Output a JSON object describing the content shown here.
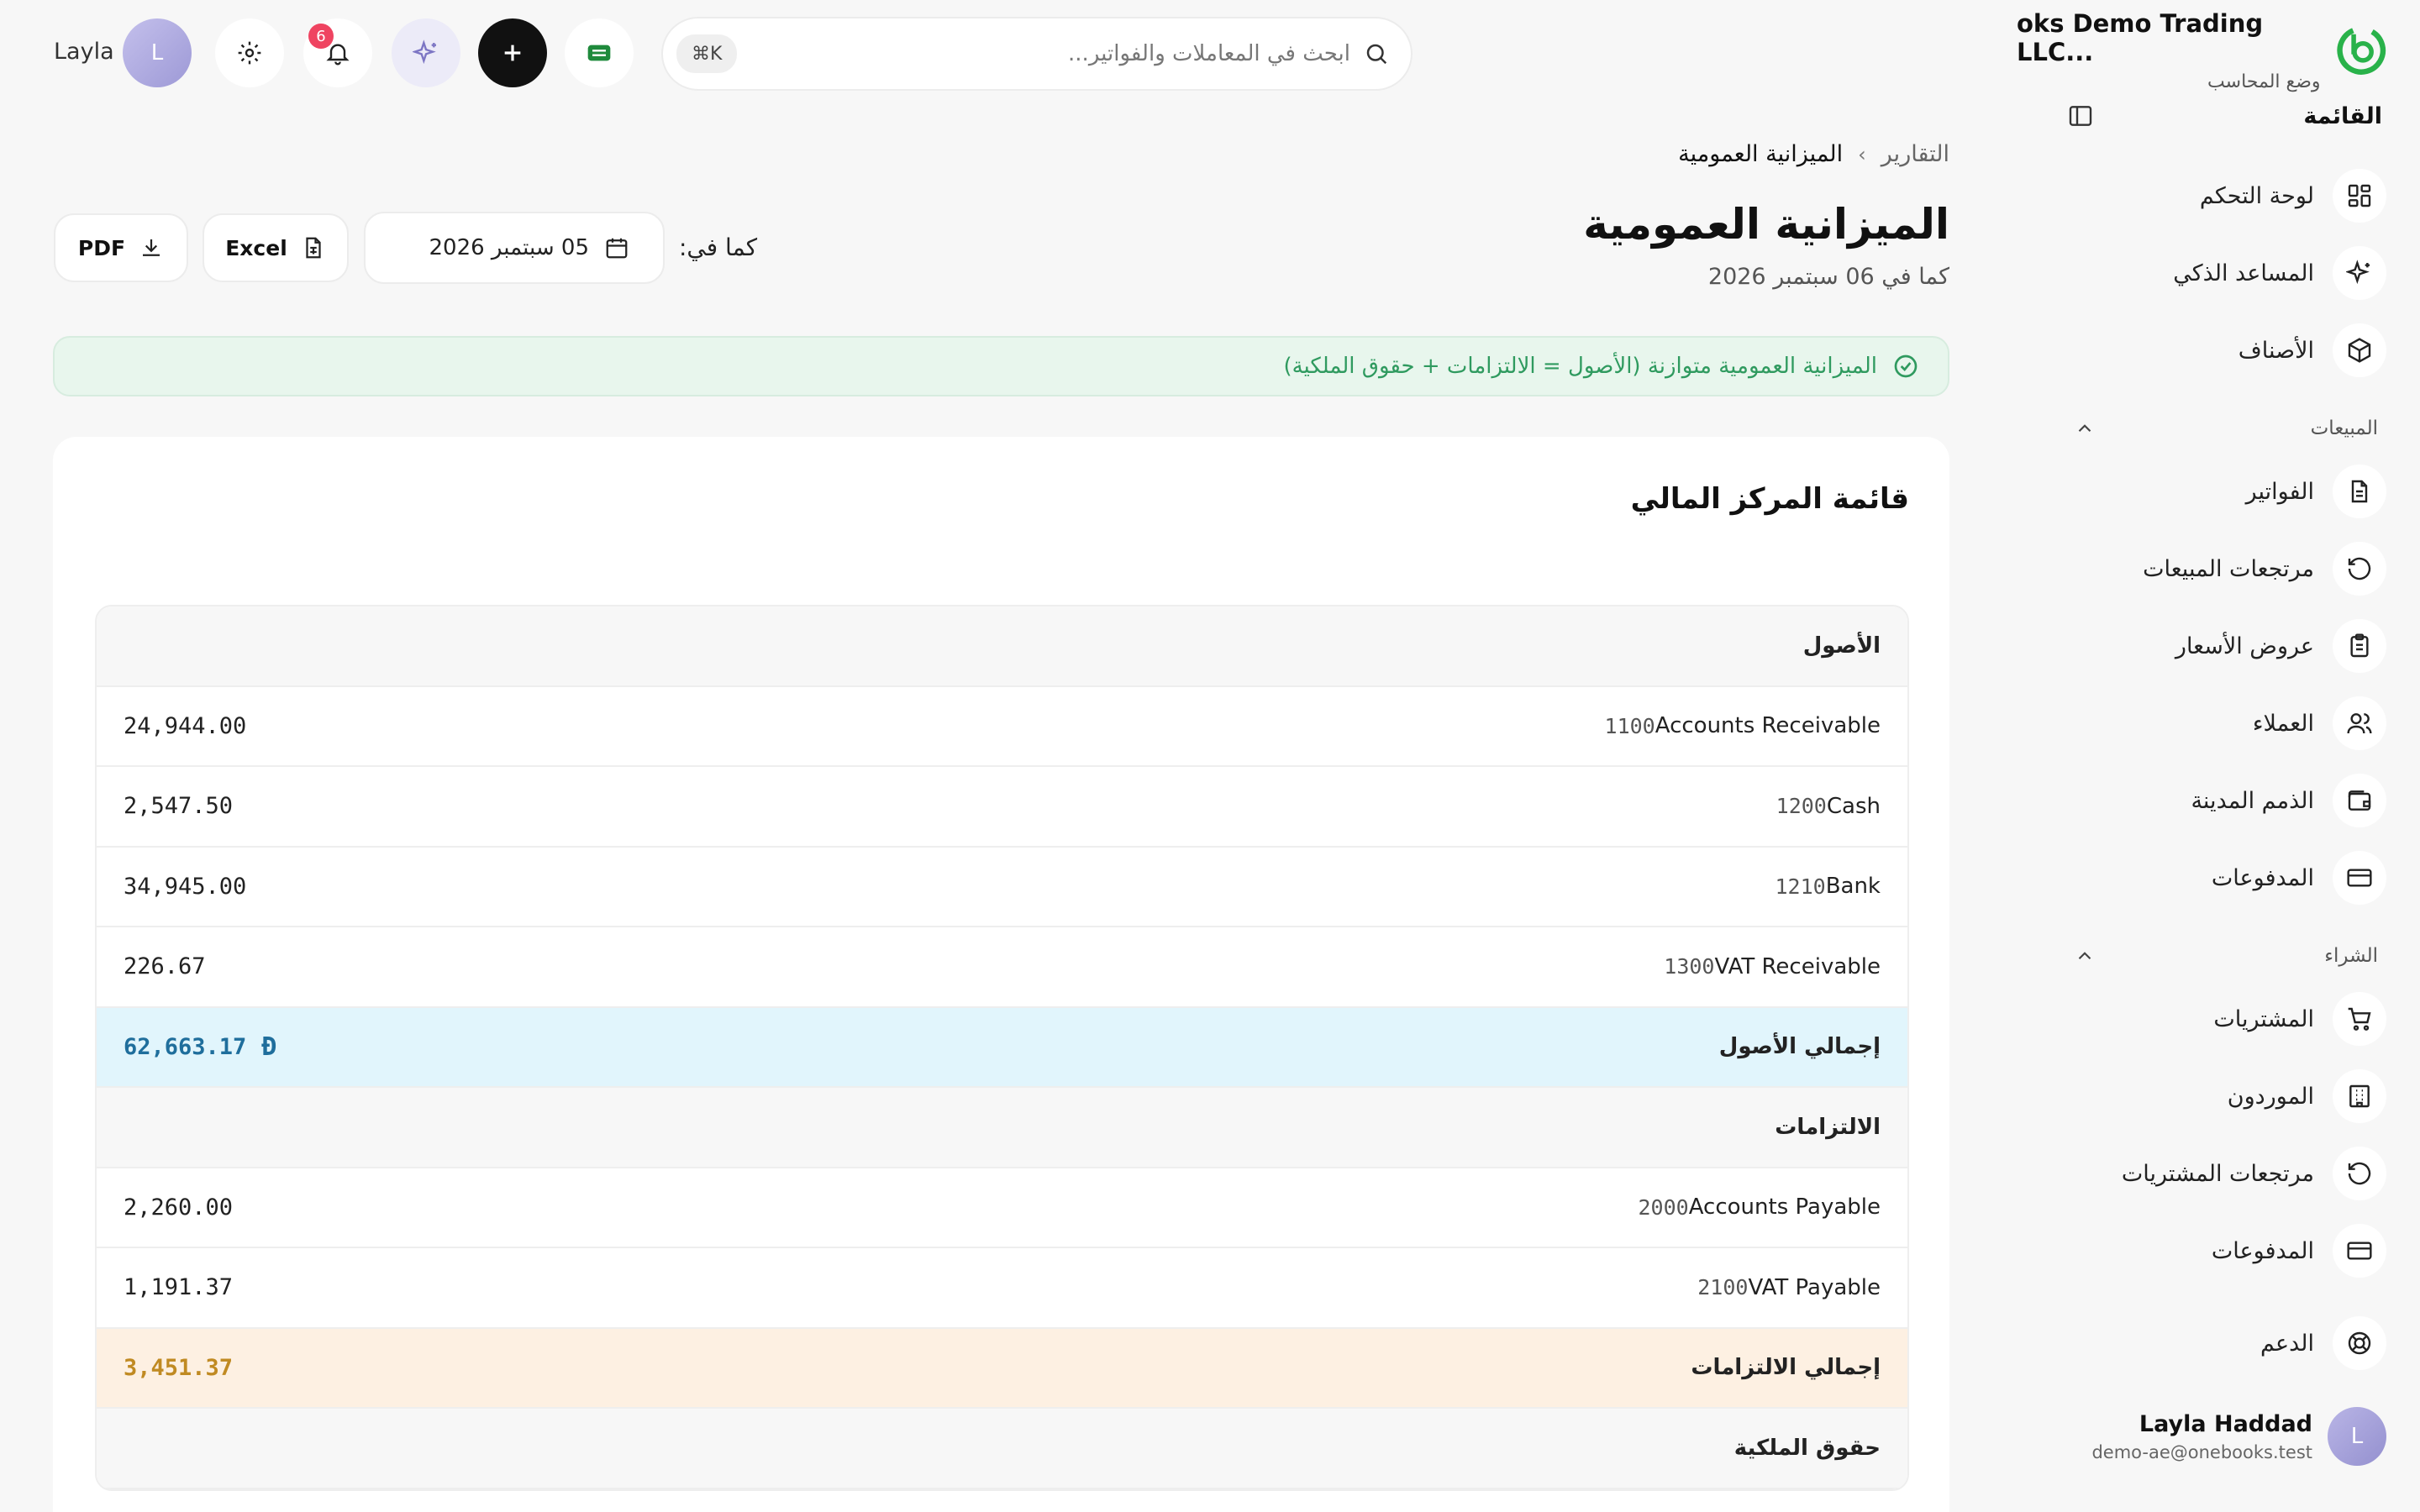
{
  "brand": {
    "name": "oks Demo Trading LLC...",
    "subtitle": "وضع المحاسب"
  },
  "menu": {
    "title": "القائمة"
  },
  "nav": {
    "dashboard": "لوحة التحكم",
    "assistant": "المساعد الذكي",
    "items": "الأصناف",
    "sales_section": "المبيعات",
    "invoices": "الفواتير",
    "sales_returns": "مرتجعات المبيعات",
    "quotes": "عروض الأسعار",
    "customers": "العملاء",
    "receivables": "الذمم المدينة",
    "payments_sales": "المدفوعات",
    "purchases_section": "الشراء",
    "purchases": "المشتريات",
    "suppliers": "الموردون",
    "purchase_returns": "مرتجعات المشتريات",
    "payments_purchases": "المدفوعات",
    "support": "الدعم"
  },
  "user": {
    "name": "Layla Haddad",
    "email": "demo-ae@onebooks.test",
    "initial": "L",
    "short_name": "Layla"
  },
  "topbar": {
    "search_placeholder": "ابحث في المعاملات والفواتير...",
    "shortcut": "⌘K",
    "notifications_count": "6"
  },
  "breadcrumb": {
    "root": "التقارير",
    "separator": "›",
    "current": "الميزانية العمومية"
  },
  "page": {
    "title": "الميزانية العمومية",
    "subtitle": "كما في 06 سبتمبر 2026"
  },
  "controls": {
    "as_of_label": "كما في:",
    "date": "05 سبتمبر 2026",
    "excel": "Excel",
    "pdf": "PDF"
  },
  "alert": {
    "text": "الميزانية العمومية متوازنة (الأصول = الالتزامات + حقوق الملكية)"
  },
  "report": {
    "title": "قائمة المركز المالي",
    "currency_symbol": "Đ",
    "assets": {
      "heading": "الأصول",
      "rows": [
        {
          "code": "1100",
          "name": "Accounts Receivable",
          "amount": "24,944.00"
        },
        {
          "code": "1200",
          "name": "Cash",
          "amount": "2,547.50"
        },
        {
          "code": "1210",
          "name": "Bank",
          "amount": "34,945.00"
        },
        {
          "code": "1300",
          "name": "VAT Receivable",
          "amount": "226.67"
        }
      ],
      "total_label": "إجمالي الأصول",
      "total": "62,663.17"
    },
    "liabilities": {
      "heading": "الالتزامات",
      "rows": [
        {
          "code": "2000",
          "name": "Accounts Payable",
          "amount": "2,260.00"
        },
        {
          "code": "2100",
          "name": "VAT Payable",
          "amount": "1,191.37"
        }
      ],
      "total_label": "إجمالي الالتزامات",
      "total": "3,451.37"
    },
    "equity": {
      "heading": "حقوق الملكية"
    }
  },
  "colors": {
    "accent_green": "#2f9a5f",
    "brand_green": "#29b24a",
    "assets_total": "#1f6e9c",
    "liabilities_total": "#c08a22",
    "badge": "#ef4461"
  }
}
